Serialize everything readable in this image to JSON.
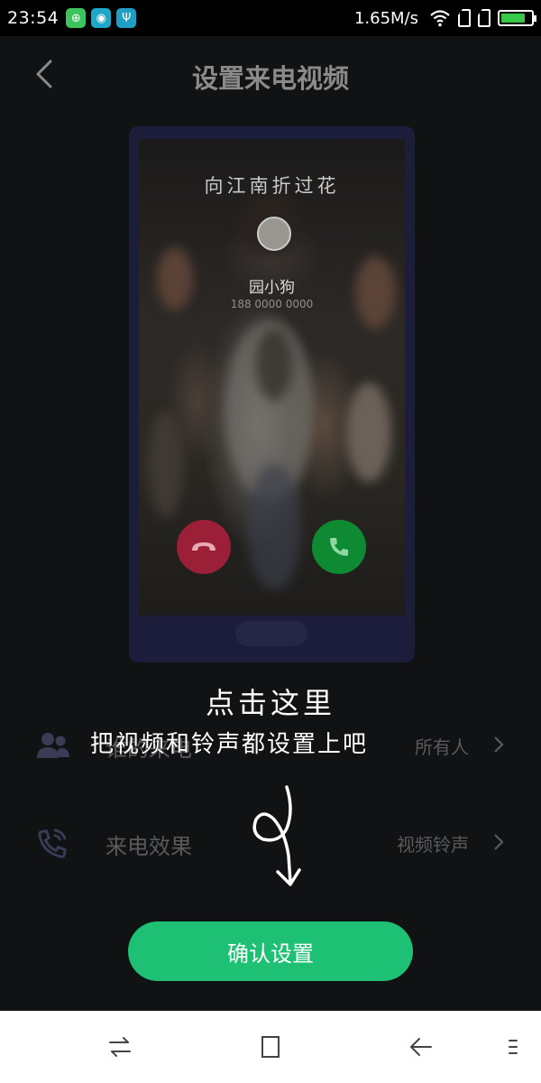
{
  "status_bar": {
    "time": "23:54",
    "network_speed": "1.65M/s",
    "app_icons": [
      {
        "name": "wechat-pay-icon",
        "color": "#3cc35c",
        "glyph": "⊕"
      },
      {
        "name": "browser-icon",
        "color": "#1ea7c8",
        "glyph": "◉"
      },
      {
        "name": "usb-icon",
        "color": "#1e9ec5",
        "glyph": "Ψ"
      }
    ],
    "battery_level": 0.8,
    "battery_color": "#37c84a"
  },
  "header": {
    "title": "设置来电视频",
    "back_icon": "chevron-left-icon"
  },
  "preview": {
    "song_title": "向江南折过花",
    "caller_name": "园小狗",
    "caller_sub": "188 0000 0000",
    "decline_color": "#9b1f36",
    "accept_color": "#0e8a32"
  },
  "settings": {
    "rows": [
      {
        "label": "谁的来电",
        "value": "所有人",
        "icon": "contacts-icon"
      },
      {
        "label": "来电效果",
        "value": "视频铃声",
        "icon": "phone-ring-icon"
      }
    ]
  },
  "hint": {
    "line1": "点击这里",
    "line2": "把视频和铃声都设置上吧"
  },
  "confirm": {
    "label": "确认设置",
    "color": "#1ec173"
  },
  "navbar": {
    "buttons": [
      "switch-icon",
      "home-square-icon",
      "back-arrow-icon",
      "menu-icon"
    ]
  }
}
